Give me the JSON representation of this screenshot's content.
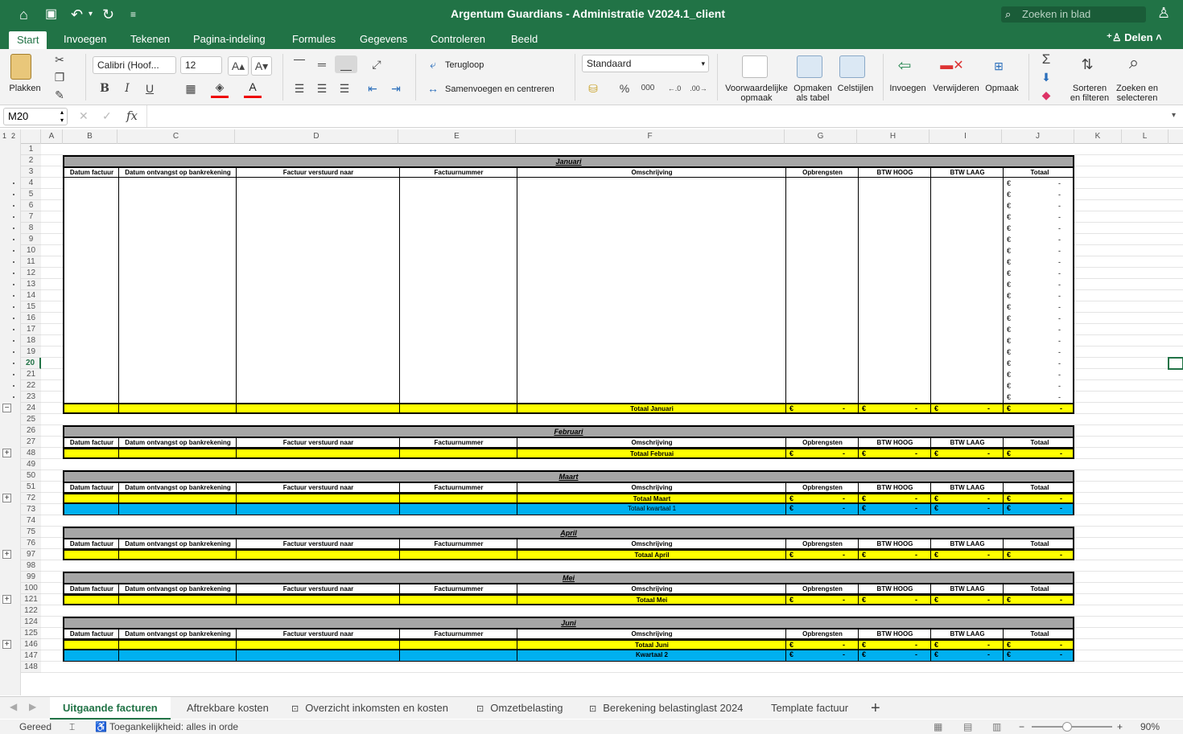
{
  "window": {
    "title": "Argentum Guardians - Administratie V2024.1_client",
    "search_placeholder": "Zoeken in blad"
  },
  "menu_tabs": [
    "Start",
    "Invoegen",
    "Tekenen",
    "Pagina-indeling",
    "Formules",
    "Gegevens",
    "Controleren",
    "Beeld"
  ],
  "share_label": "Delen",
  "ribbon": {
    "paste": "Plakken",
    "font_name": "Calibri (Hoof...",
    "font_size": "12",
    "bold": "B",
    "italic": "I",
    "underline": "U",
    "wrap": "Terugloop",
    "merge": "Samenvoegen en centreren",
    "number_format": "Standaard",
    "percent": "%",
    "thousands": "000",
    "cond_format": [
      "Voorwaardelijke",
      "opmaak"
    ],
    "format_table": [
      "Opmaken",
      "als tabel"
    ],
    "cell_styles": "Celstijlen",
    "insert": "Invoegen",
    "delete": "Verwijderen",
    "format": "Opmaak",
    "sort": [
      "Sorteren",
      "en filteren"
    ],
    "find": [
      "Zoeken en",
      "selecteren"
    ]
  },
  "formula_bar": {
    "name_box": "M20",
    "fx": "fx",
    "content": ""
  },
  "outline_levels": [
    "1",
    "2"
  ],
  "columns": [
    "A",
    "B",
    "C",
    "D",
    "E",
    "F",
    "G",
    "H",
    "I",
    "J",
    "K",
    "L"
  ],
  "headers": [
    "Datum factuur",
    "Datum ontvangst op bankrekening",
    "Factuur verstuurd naar",
    "Factuurnummer",
    "Omschrijving",
    "Opbrengsten",
    "BTW HOOG",
    "BTW LAAG",
    "Totaal"
  ],
  "euro": "€",
  "dash": "-",
  "rows": [
    {
      "n": "1",
      "type": "blank"
    },
    {
      "n": "2",
      "type": "month",
      "label": "Januari"
    },
    {
      "n": "3",
      "type": "header"
    },
    {
      "n": "4",
      "type": "data"
    },
    {
      "n": "5",
      "type": "data"
    },
    {
      "n": "6",
      "type": "data"
    },
    {
      "n": "7",
      "type": "data"
    },
    {
      "n": "8",
      "type": "data"
    },
    {
      "n": "9",
      "type": "data"
    },
    {
      "n": "10",
      "type": "data"
    },
    {
      "n": "11",
      "type": "data"
    },
    {
      "n": "12",
      "type": "data"
    },
    {
      "n": "13",
      "type": "data"
    },
    {
      "n": "14",
      "type": "data"
    },
    {
      "n": "15",
      "type": "data"
    },
    {
      "n": "16",
      "type": "data"
    },
    {
      "n": "17",
      "type": "data"
    },
    {
      "n": "18",
      "type": "data"
    },
    {
      "n": "19",
      "type": "data"
    },
    {
      "n": "20",
      "type": "data"
    },
    {
      "n": "21",
      "type": "data"
    },
    {
      "n": "22",
      "type": "data"
    },
    {
      "n": "23",
      "type": "data"
    },
    {
      "n": "24",
      "type": "total",
      "label": "Totaal Januari",
      "outline": "−"
    },
    {
      "n": "25",
      "type": "blank"
    },
    {
      "n": "26",
      "type": "month",
      "label": "Februari"
    },
    {
      "n": "27",
      "type": "header"
    },
    {
      "n": "48",
      "type": "total",
      "label": "Totaal Februai",
      "outline": "+"
    },
    {
      "n": "49",
      "type": "blank"
    },
    {
      "n": "50",
      "type": "month",
      "label": "Maart"
    },
    {
      "n": "51",
      "type": "header"
    },
    {
      "n": "72",
      "type": "total",
      "label": "Totaal Maart",
      "outline": "+"
    },
    {
      "n": "73",
      "type": "quarter",
      "label": "Totaal kwartaal 1"
    },
    {
      "n": "74",
      "type": "blank"
    },
    {
      "n": "75",
      "type": "month",
      "label": "April"
    },
    {
      "n": "76",
      "type": "header"
    },
    {
      "n": "97",
      "type": "total",
      "label": "Totaal April",
      "outline": "+"
    },
    {
      "n": "98",
      "type": "blank"
    },
    {
      "n": "99",
      "type": "month",
      "label": "Mei"
    },
    {
      "n": "100",
      "type": "header"
    },
    {
      "n": "121",
      "type": "total",
      "label": "Totaal Mei",
      "outline": "+"
    },
    {
      "n": "122",
      "type": "blank"
    },
    {
      "n": "124",
      "type": "month",
      "label": "Juni"
    },
    {
      "n": "125",
      "type": "header"
    },
    {
      "n": "146",
      "type": "total",
      "label": "Totaal Juni",
      "outline": "+"
    },
    {
      "n": "147",
      "type": "quarter",
      "label": "Kwartaal 2"
    },
    {
      "n": "148",
      "type": "blank"
    }
  ],
  "selected_row": "20",
  "sheet_tabs": [
    {
      "label": "Uitgaande facturen",
      "active": true,
      "locked": false
    },
    {
      "label": "Aftrekbare kosten",
      "active": false,
      "locked": false
    },
    {
      "label": "Overzicht inkomsten en kosten",
      "active": false,
      "locked": true
    },
    {
      "label": "Omzetbelasting",
      "active": false,
      "locked": true
    },
    {
      "label": "Berekening belastinglast 2024",
      "active": false,
      "locked": true
    },
    {
      "label": "Template factuur",
      "active": false,
      "locked": false
    }
  ],
  "add_sheet": "+",
  "status": {
    "ready": "Gereed",
    "accessibility": "Toegankelijkheid: alles in orde",
    "zoom": "90%"
  },
  "colors": {
    "brand": "#217346",
    "total": "#ffff00",
    "quarter": "#00b0f0",
    "month_bar": "#a6a6a6"
  }
}
